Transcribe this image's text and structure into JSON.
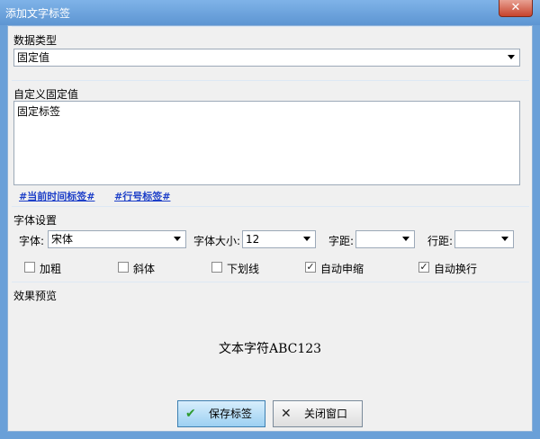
{
  "window": {
    "title": "添加文字标签",
    "close_glyph": "✕"
  },
  "data_type": {
    "group_label": "数据类型",
    "selected": "固定值"
  },
  "custom_value": {
    "group_label": "自定义固定值",
    "value": "固定标签"
  },
  "links": {
    "current_time": "#当前时间标签#",
    "row_number": "#行号标签#"
  },
  "font_settings": {
    "group_label": "字体设置",
    "font_label": "字体:",
    "font_value": "宋体",
    "size_label": "字体大小:",
    "size_value": "12",
    "spacing_label": "字距:",
    "spacing_value": "",
    "line_spacing_label": "行距:",
    "line_spacing_value": "",
    "checkboxes": [
      {
        "label": "加粗",
        "checked": false
      },
      {
        "label": "斜体",
        "checked": false
      },
      {
        "label": "下划线",
        "checked": false
      },
      {
        "label": "自动申缩",
        "checked": true
      },
      {
        "label": "自动换行",
        "checked": true
      }
    ]
  },
  "preview": {
    "group_label": "效果预览",
    "text": "文本字符ABC123"
  },
  "buttons": {
    "save": "保存标签",
    "close": "关闭窗口"
  },
  "icons": {
    "save": "check-icon",
    "close": "x-icon"
  },
  "colors": {
    "titlebar": "#6aa0d8",
    "link": "#1d3fc8",
    "primary_button": "#9cd0f2",
    "close_button": "#c7432c"
  }
}
